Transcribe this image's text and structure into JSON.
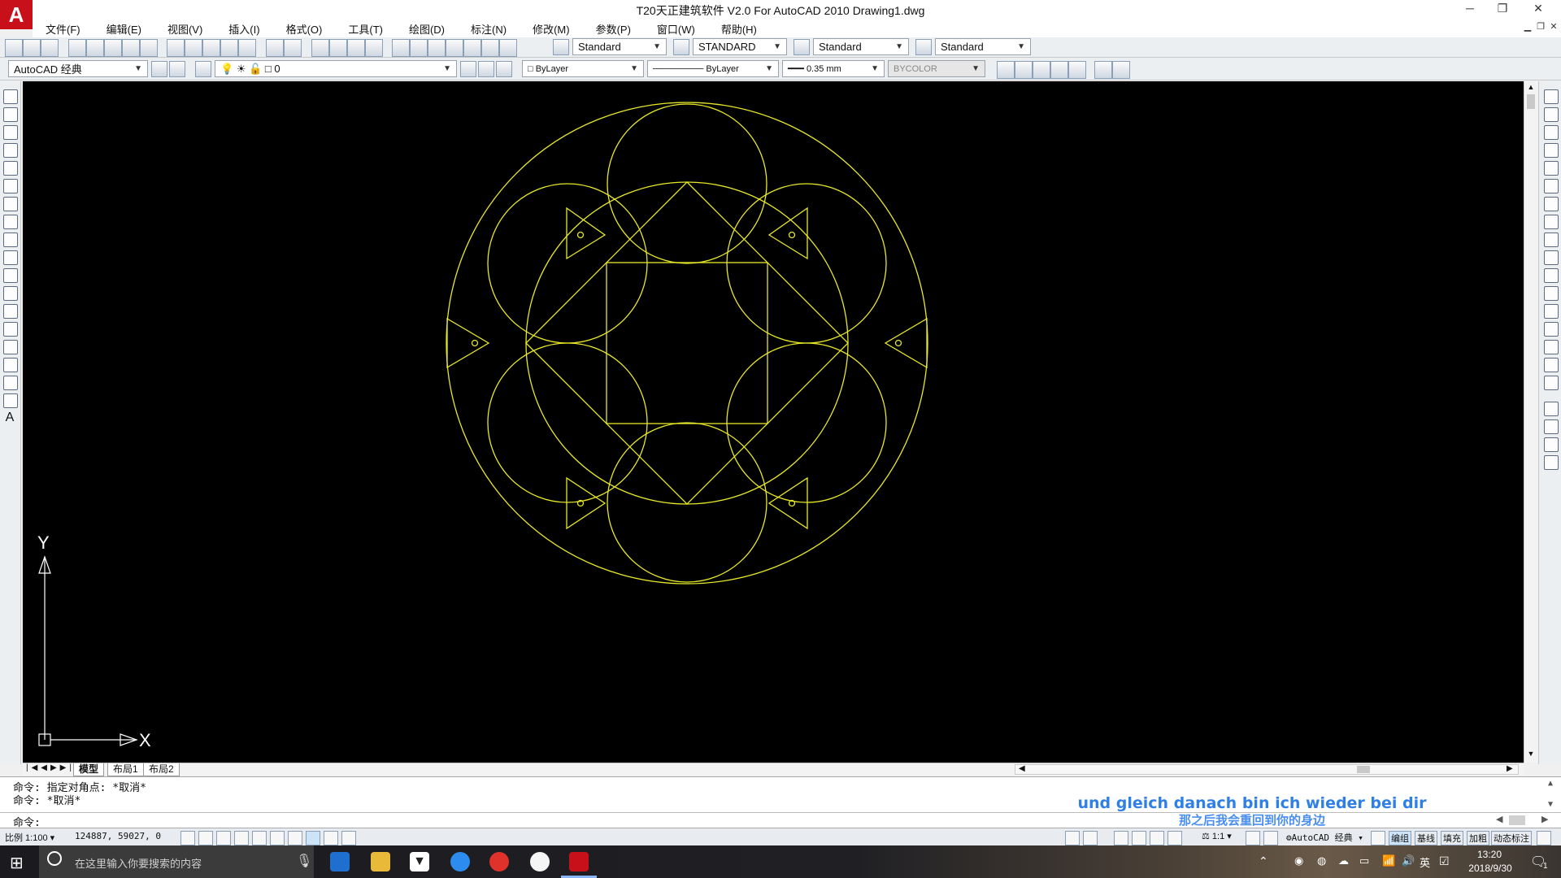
{
  "window": {
    "title": "T20天正建筑软件 V2.0 For AutoCAD 2010      Drawing1.dwg",
    "logo_letter": "A"
  },
  "menubar": {
    "items": [
      "文件(F)",
      "编辑(E)",
      "视图(V)",
      "插入(I)",
      "格式(O)",
      "工具(T)",
      "绘图(D)",
      "标注(N)",
      "修改(M)",
      "参数(P)",
      "窗口(W)",
      "帮助(H)"
    ]
  },
  "toolbar1": {
    "text_style": "Standard",
    "dim_style": "STANDARD",
    "table_style": "Standard",
    "mleader_style": "Standard"
  },
  "toolbar2": {
    "workspace": "AutoCAD 经典",
    "layer": "0",
    "color": "ByLayer",
    "linetype": "ByLayer",
    "lineweight": "0.35 mm",
    "plotstyle": "BYCOLOR"
  },
  "ucs": {
    "x_label": "X",
    "y_label": "Y"
  },
  "tabs": {
    "model": "模型",
    "layout1": "布局1",
    "layout2": "布局2"
  },
  "command": {
    "history": [
      "命令: 指定对角点: *取消*",
      "命令: *取消*"
    ],
    "prompt": "命令:"
  },
  "subtitles": {
    "german": "und gleich danach bin ich wieder bei dir",
    "chinese": "那之后我会重回到你的身边"
  },
  "statusbar": {
    "scale": "比例 1:100",
    "coords": "124887, 59027, 0",
    "annotation_scale": "1:1",
    "workspace": "AutoCAD 经典",
    "buttons": [
      "编组",
      "基线",
      "填充",
      "加粗",
      "动态标注"
    ]
  },
  "taskbar": {
    "search_placeholder": "在这里输入你要搜索的内容",
    "ime": "英",
    "time": "13:20",
    "date": "2018/9/30",
    "notification_count": "1"
  },
  "colors": {
    "drawing_stroke": "#e8e82a",
    "canvas_bg": "#000000",
    "subtitle_de": "#2f7fe8",
    "subtitle_zh": "#4a8ff0"
  }
}
